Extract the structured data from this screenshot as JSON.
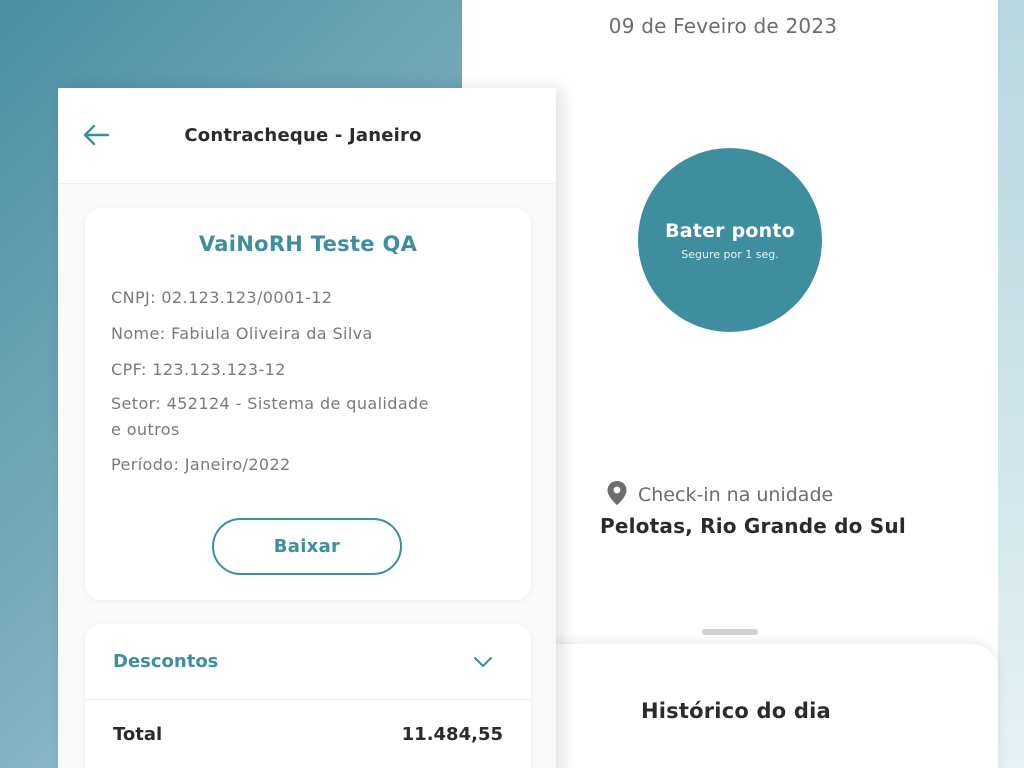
{
  "payslip": {
    "header_title": "Contracheque - Janeiro",
    "company": "VaiNoRH Teste QA",
    "cnpj": "CNPJ: 02.123.123/0001-12",
    "nome": "Nome: Fabiula Oliveira da Silva",
    "cpf": "CPF: 123.123.123-12",
    "setor_line1": "Setor: 452124 - Sistema de qualidade",
    "setor_line2": "e outros",
    "periodo": "Período: Janeiro/2022",
    "download_label": "Baixar",
    "discounts_label": "Descontos",
    "total_label": "Total",
    "total_value": "11.484,55"
  },
  "ponto": {
    "date": "09 de Feveiro de 2023",
    "button_title": "Bater ponto",
    "button_subtitle": "Segure por 1 seg.",
    "checkin_label": "Check-in na unidade",
    "location": "Pelotas, Rio Grande do Sul",
    "history_title": "Histórico do dia"
  },
  "icons": {
    "back": "arrow-left-icon",
    "chevron": "chevron-down-icon",
    "location": "map-pin-icon"
  },
  "colors": {
    "accent": "#3f8ea0",
    "text_dark": "#2b2b2b",
    "text_muted": "#7a7a7a"
  }
}
